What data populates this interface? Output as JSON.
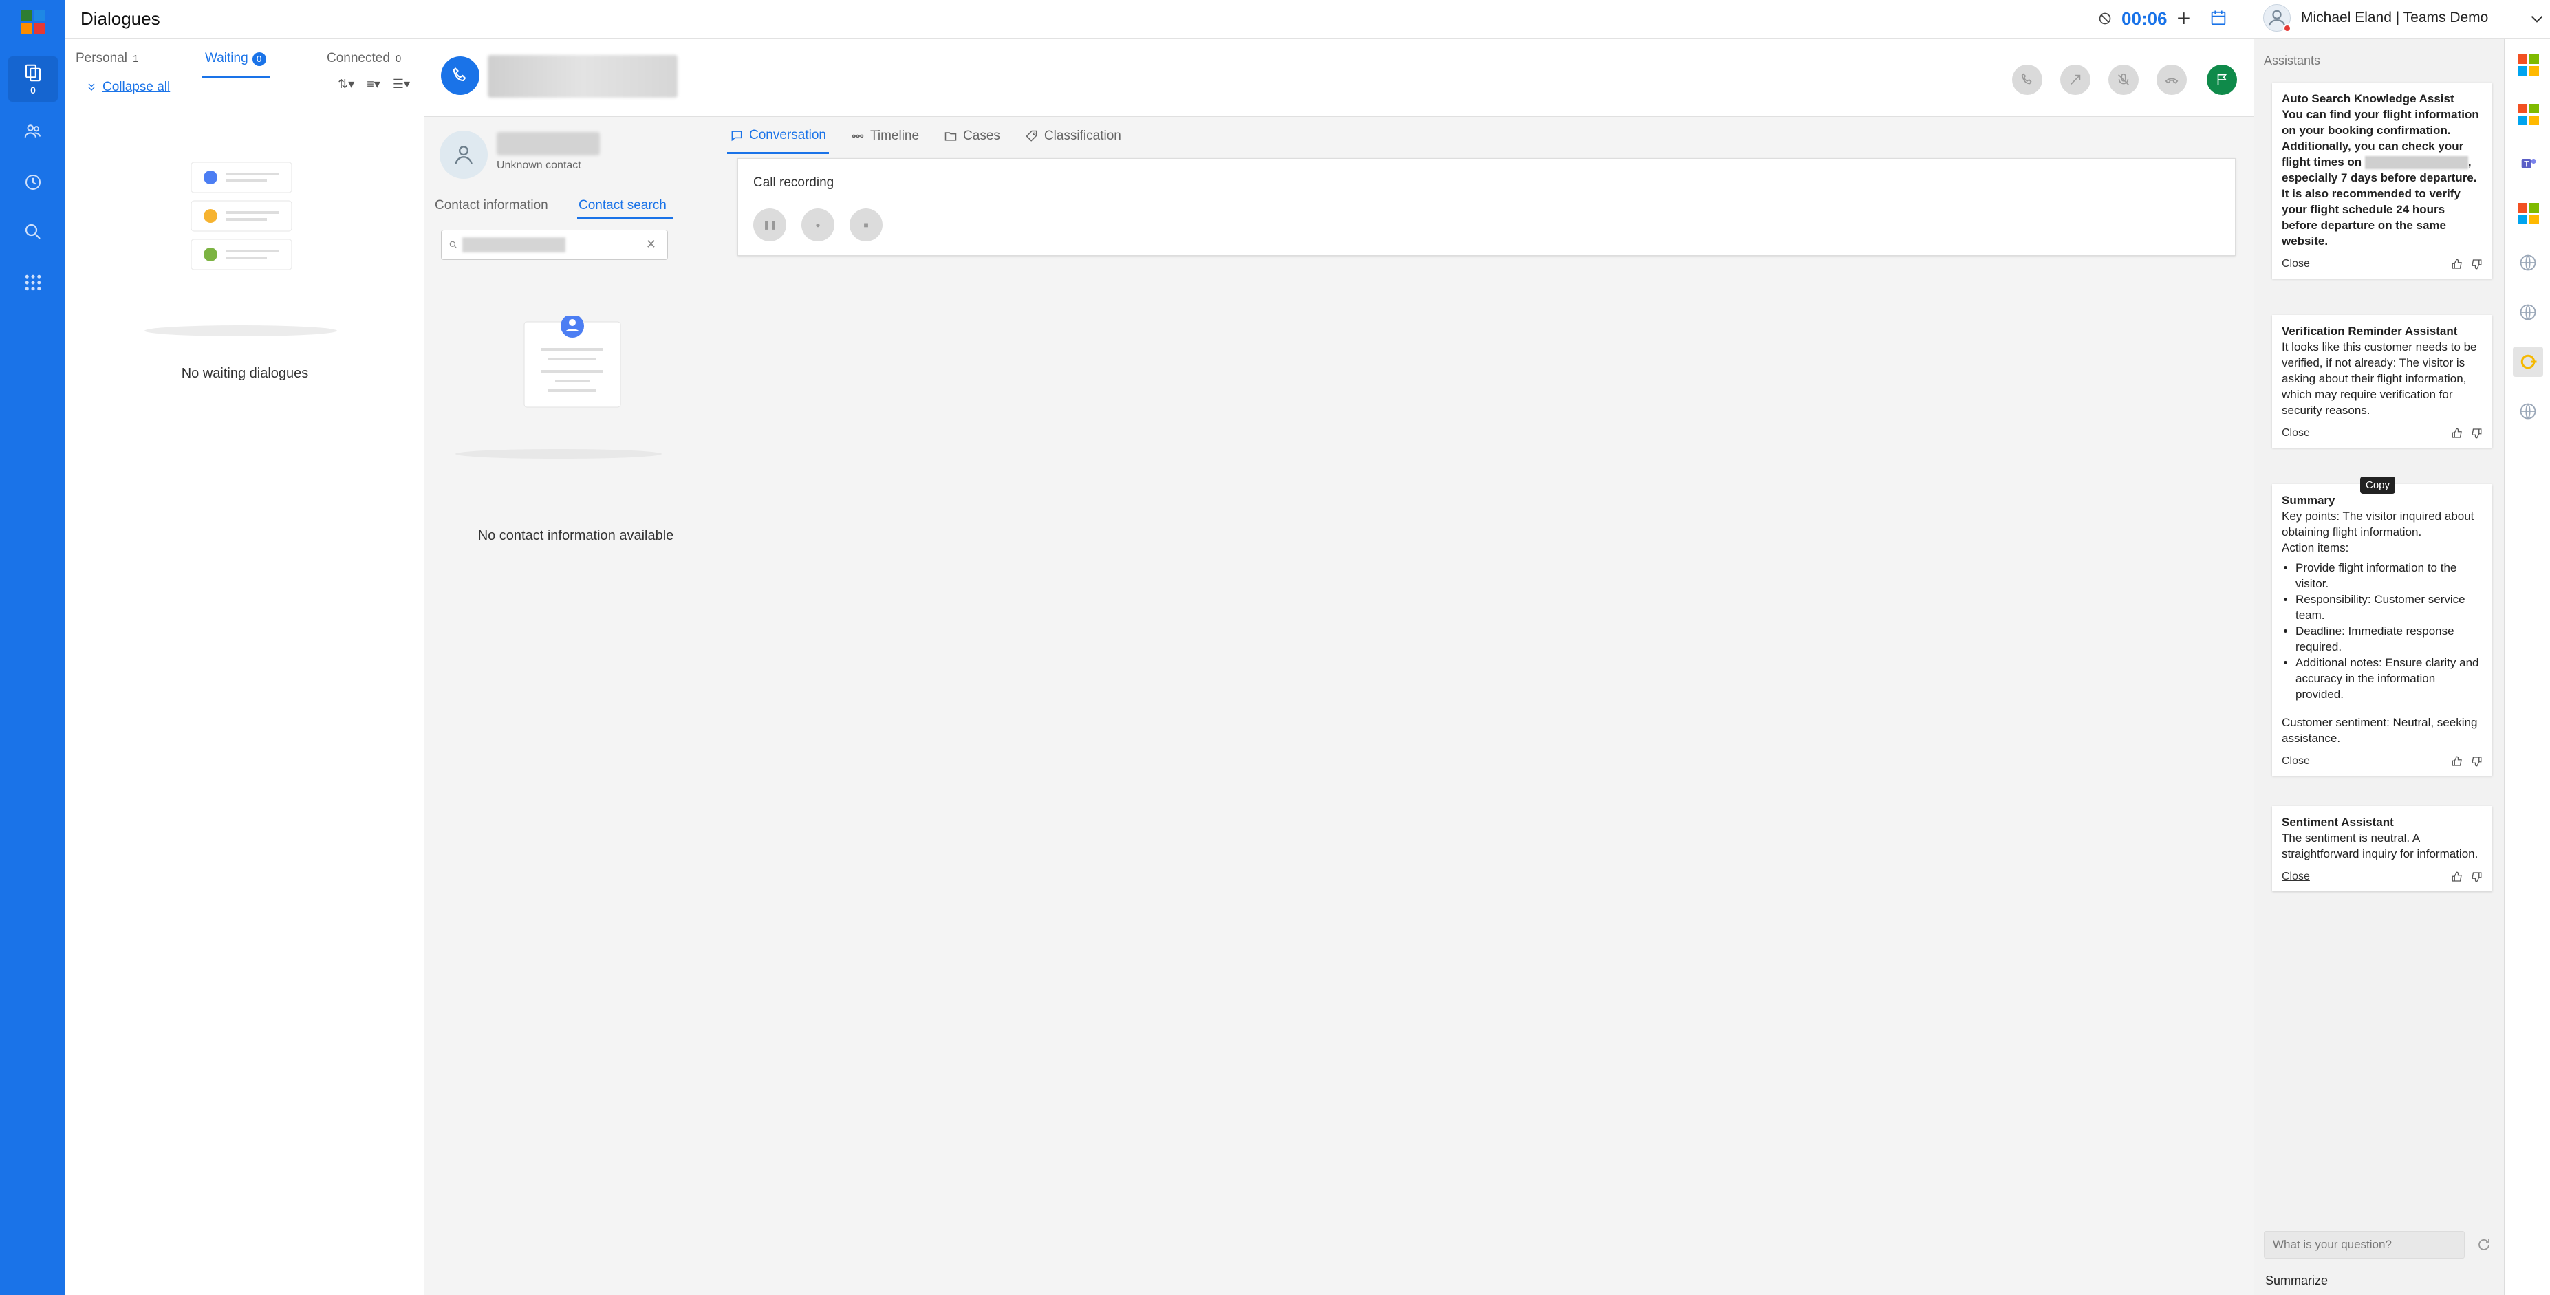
{
  "topbar": {
    "title": "Dialogues",
    "timer": "00:06",
    "user": "Michael Eland | Teams Demo"
  },
  "rail": {
    "badge": "0"
  },
  "dialogues": {
    "tabs": [
      {
        "label": "Personal",
        "count": "1"
      },
      {
        "label": "Waiting",
        "count": "0"
      },
      {
        "label": "Connected",
        "count": "0"
      }
    ],
    "collapse_label": "Collapse all",
    "empty": "No waiting dialogues"
  },
  "contact": {
    "unknown": "Unknown contact",
    "tabs": [
      "Contact information",
      "Contact search"
    ],
    "empty": "No contact information available"
  },
  "conversation": {
    "tabs": [
      "Conversation",
      "Timeline",
      "Cases",
      "Classification"
    ],
    "recording_title": "Call recording"
  },
  "assistants": {
    "header": "Assistants",
    "cards": [
      {
        "title": "Auto Search Knowledge Assist",
        "body_a": "You can find your flight information on your booking confirmation. Additionally, you can check your flight times on",
        "body_b": ", especially 7 days before departure. It is also recommended to verify your flight schedule 24 hours before departure on the same website.",
        "close": "Close"
      },
      {
        "title": "Verification Reminder Assistant",
        "body": "It looks like this customer needs to be verified, if not already: The visitor is asking about their flight information, which may require verification for security reasons.",
        "close": "Close"
      },
      {
        "title": "Summary",
        "intro": "Key points: The visitor inquired about obtaining flight information.",
        "action": "Action items:",
        "items": [
          "Provide flight information to the visitor.",
          "Responsibility: Customer service team.",
          "Deadline: Immediate response required.",
          "Additional notes: Ensure clarity and accuracy in the information provided."
        ],
        "sentiment": "Customer sentiment: Neutral, seeking assistance.",
        "close": "Close"
      },
      {
        "title": "Sentiment Assistant",
        "body": "The sentiment is neutral. A straightforward inquiry for information.",
        "close": "Close"
      }
    ],
    "tooltip": "Copy",
    "ask_placeholder": "What is your question?",
    "summarize": "Summarize"
  },
  "colors": {
    "brand": "#1a73e8",
    "call_active": "#0f8a4a"
  }
}
